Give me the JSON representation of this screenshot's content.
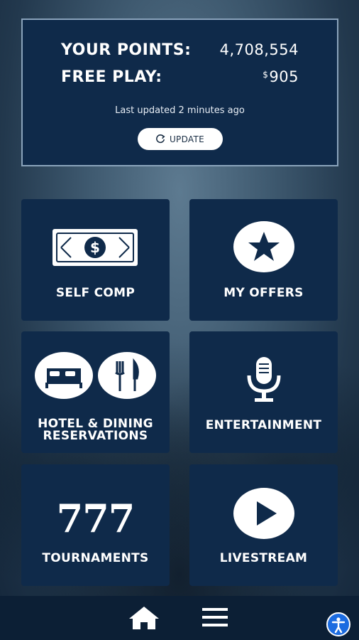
{
  "points_card": {
    "points_label": "YOUR POINTS:",
    "points_value": "4,708,554",
    "freeplay_label": "FREE PLAY:",
    "freeplay_currency": "$",
    "freeplay_value": "905",
    "last_updated": "Last updated 2 minutes ago",
    "update_label": "UPDATE"
  },
  "tiles": [
    {
      "label": "SELF COMP",
      "icon": "dollar-bill-icon"
    },
    {
      "label": "MY OFFERS",
      "icon": "star-icon"
    },
    {
      "label_line1": "HOTEL & DINING",
      "label_line2": "RESERVATIONS",
      "icons": [
        "bed-icon",
        "fork-knife-icon"
      ]
    },
    {
      "label": "ENTERTAINMENT",
      "icon": "microphone-icon"
    },
    {
      "label": "TOURNAMENTS",
      "icon_text": "777"
    },
    {
      "label": "LIVESTREAM",
      "icon": "play-icon"
    }
  ],
  "nav": {
    "home_icon": "home-icon",
    "menu_icon": "hamburger-menu-icon",
    "accessibility_icon": "accessibility-icon"
  },
  "colors": {
    "card_bg": "#0f2a4a",
    "card_border": "#8aa3bb",
    "nav_bg": "#0c1f35",
    "accessibility_blue": "#1b6be0"
  }
}
